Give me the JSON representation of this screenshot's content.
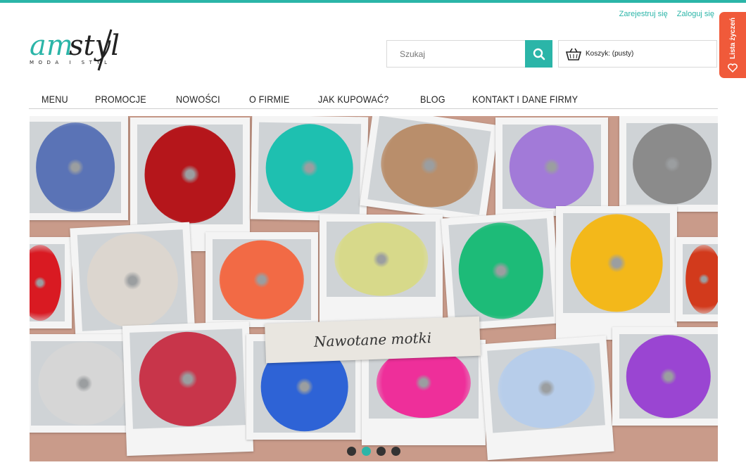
{
  "header": {
    "register_label": "Zarejestruj się",
    "login_label": "Zaloguj się",
    "logo_text": "amstyl",
    "logo_tagline": "MODA I STYL"
  },
  "search": {
    "placeholder": "Szukaj"
  },
  "cart": {
    "label": "Koszyk: (pusty)"
  },
  "wishlist": {
    "label": "Lista życzeń"
  },
  "nav": {
    "items": [
      "MENU",
      "PROMOCJE",
      "NOWOŚCI",
      "O FIRMIE",
      "JAK KUPOWAĆ?",
      "BLOG",
      "KONTAKT I DANE FIRMY"
    ]
  },
  "banner": {
    "caption": "Nawotane motki",
    "active_slide": 2,
    "slide_count": 4,
    "yarn_colors": [
      "#5a73b6",
      "#b5161b",
      "#1ec0b0",
      "#b98e6b",
      "#a27ad8",
      "#8b8b8b",
      "#d91a22",
      "#dcd6cf",
      "#f26a45",
      "#d7d98a",
      "#1dbb78",
      "#f3b81a",
      "#d23a1c",
      "#d6d6d6",
      "#c8354a",
      "#2e63d6",
      "#ee2f9a",
      "#b7cdea",
      "#9a45d2"
    ]
  },
  "colors": {
    "accent": "#2bb5a8",
    "wishlist": "#f05a3a"
  }
}
